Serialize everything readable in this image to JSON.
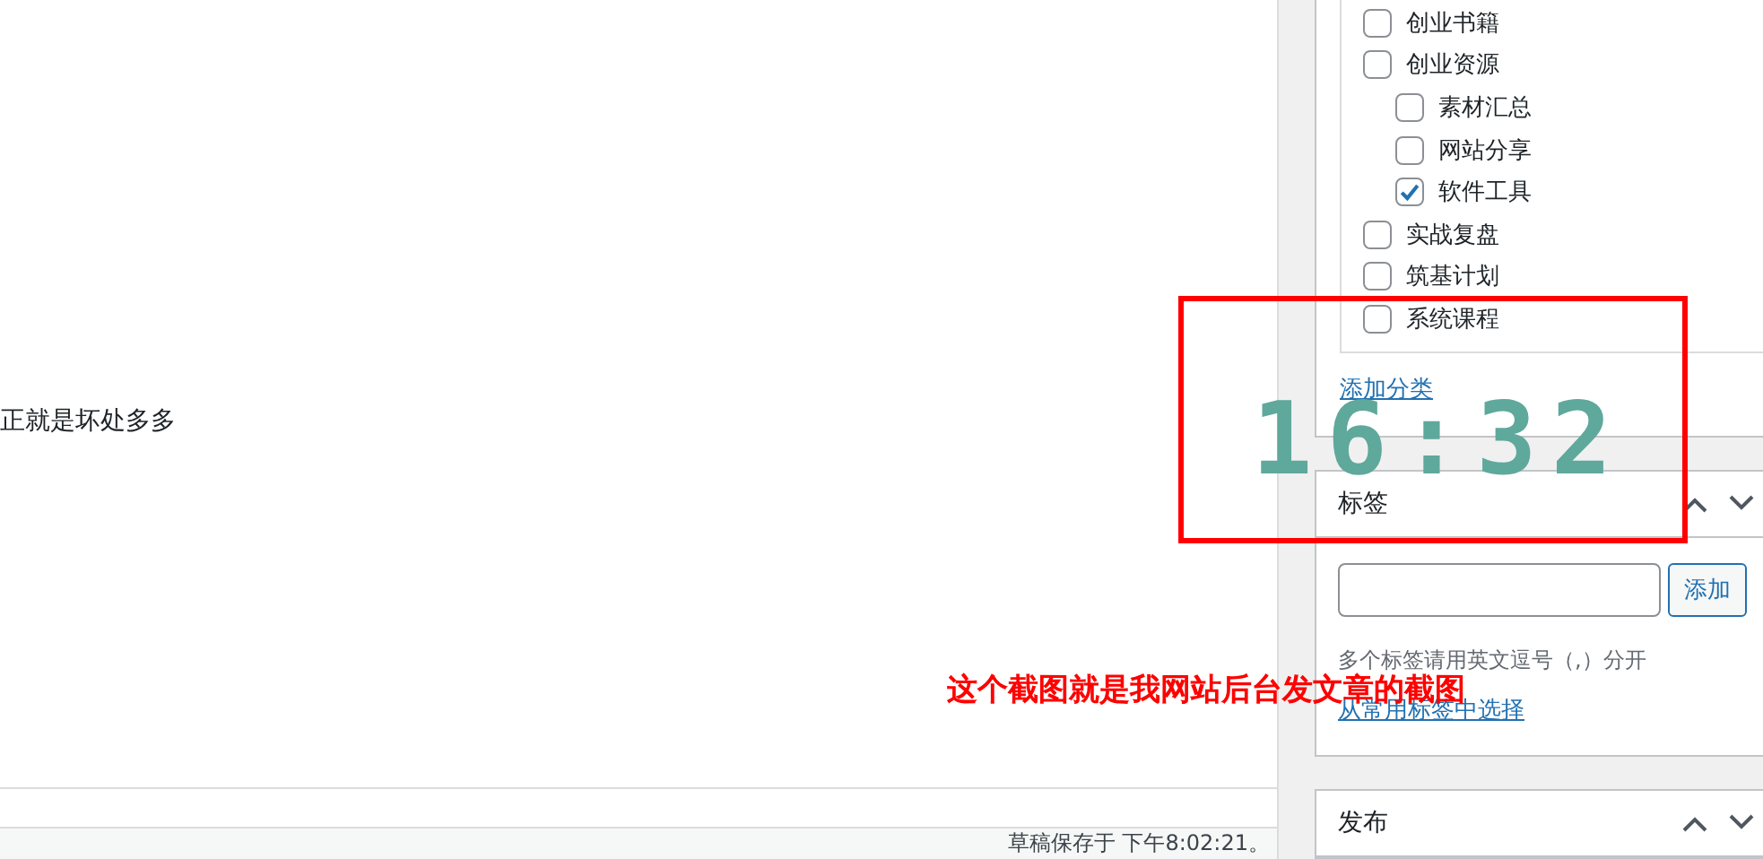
{
  "editor": {
    "text": "正就是坏处多多"
  },
  "status_bar": {
    "text": "草稿保存于 下午8:02:21。"
  },
  "categories": {
    "items": [
      {
        "label": "创业书籍",
        "checked": false
      },
      {
        "label": "创业资源",
        "checked": false,
        "children": [
          {
            "label": "素材汇总",
            "checked": false
          },
          {
            "label": "网站分享",
            "checked": false
          },
          {
            "label": "软件工具",
            "checked": true
          }
        ]
      },
      {
        "label": "实战复盘",
        "checked": false
      },
      {
        "label": "筑基计划",
        "checked": false
      },
      {
        "label": "系统课程",
        "checked": false
      }
    ],
    "add_link": "添加分类"
  },
  "tags_box": {
    "title": "标签",
    "add_button": "添加",
    "hint": "多个标签请用英文逗号（,）分开",
    "choose_link": "从常用标签中选择"
  },
  "publish_box": {
    "title": "发布"
  },
  "overlay": {
    "clock": "16:32",
    "caption": "这个截图就是我网站后台发文章的截图"
  }
}
